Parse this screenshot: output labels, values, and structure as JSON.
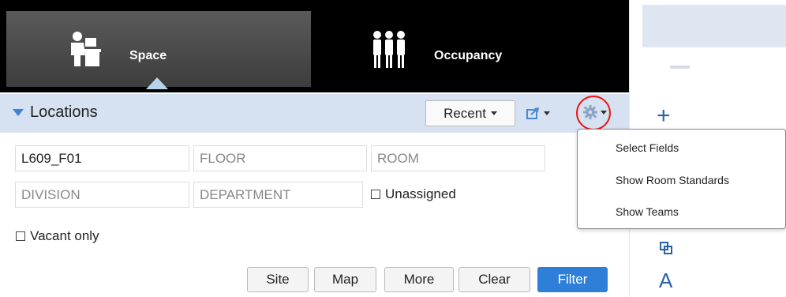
{
  "nav": {
    "tabs": [
      {
        "label": "Space",
        "icon": "person-desk-icon",
        "active": true
      },
      {
        "label": "Occupancy",
        "icon": "people-group-icon",
        "active": false
      }
    ]
  },
  "locations": {
    "title": "Locations",
    "recent_label": "Recent",
    "fields": {
      "building": {
        "value": "L609_F01",
        "placeholder": ""
      },
      "floor": {
        "value": "",
        "placeholder": "FLOOR"
      },
      "room": {
        "value": "",
        "placeholder": "ROOM"
      },
      "division": {
        "value": "",
        "placeholder": "DIVISION"
      },
      "department": {
        "value": "",
        "placeholder": "DEPARTMENT"
      }
    },
    "unassigned_label": "Unassigned",
    "vacant_label": "Vacant only",
    "buttons": {
      "site": "Site",
      "map": "Map",
      "more": "More",
      "clear": "Clear",
      "filter": "Filter"
    }
  },
  "gear_menu": {
    "items": [
      "Select Fields",
      "Show Room Standards",
      "Show Teams"
    ]
  },
  "colors": {
    "nav_bg": "#000000",
    "header_bg": "#d6e1f1",
    "accent": "#2f7fd8",
    "highlight_circle": "#e11111"
  }
}
